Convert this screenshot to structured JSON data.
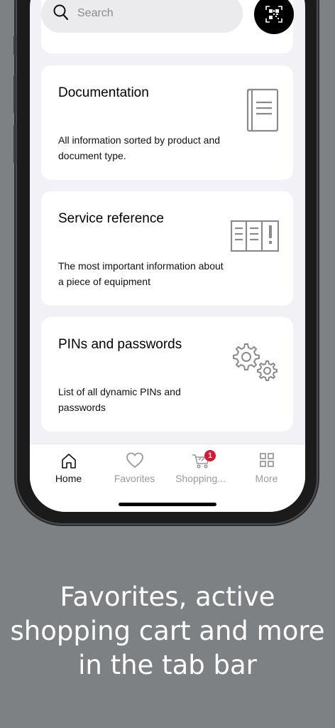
{
  "search": {
    "placeholder": "Search"
  },
  "cards": [
    {
      "title": "Documentation",
      "description": "All information sorted by product and document type.",
      "icon": "book-icon"
    },
    {
      "title": "Service reference",
      "description": "The most important information about a piece of equipment",
      "icon": "service-panel-icon"
    },
    {
      "title": "PINs and passwords",
      "description": "List of all dynamic PINs and passwords",
      "icon": "gears-icon"
    }
  ],
  "tabs": [
    {
      "label": "Home",
      "icon": "home-icon",
      "active": true
    },
    {
      "label": "Favorites",
      "icon": "heart-icon"
    },
    {
      "label": "Shopping...",
      "icon": "cart-icon",
      "badge": "1"
    },
    {
      "label": "More",
      "icon": "grid-icon"
    }
  ],
  "caption": "Favorites, active shopping cart and more in the tab bar",
  "colors": {
    "badge": "#e0142c",
    "background": "#7d8183"
  }
}
